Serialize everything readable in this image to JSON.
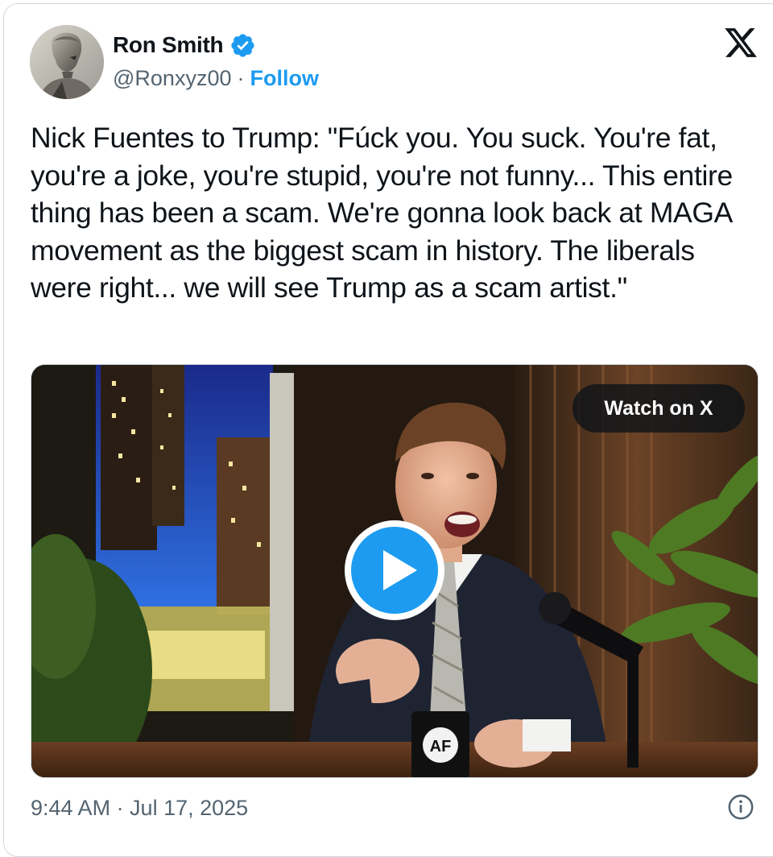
{
  "author": {
    "name": "Ron Smith",
    "handle": "@Ronxyz00",
    "separator": "·",
    "follow_label": "Follow",
    "verified": true,
    "avatar_icon": "statue-avatar-icon"
  },
  "brand": {
    "logo": "x-logo-icon",
    "accent_color": "#1d9bf0",
    "text_color": "#0f1419",
    "secondary_text_color": "#536471"
  },
  "tweet": {
    "text": "Nick Fuentes to Trump: \"Fúck you. You suck. You're fat, you're a joke, you're stupid, you're not funny... This entire thing has been a scam. We're gonna look back at MAGA movement as the biggest scam in history. The liberals were right... we will see Trump as a scam artist.\""
  },
  "media": {
    "watch_label": "Watch on X",
    "play_icon": "play-icon",
    "mug_logo": "AF"
  },
  "footer": {
    "timestamp": "9:44 AM · Jul 17, 2025",
    "info_icon": "info-icon"
  }
}
